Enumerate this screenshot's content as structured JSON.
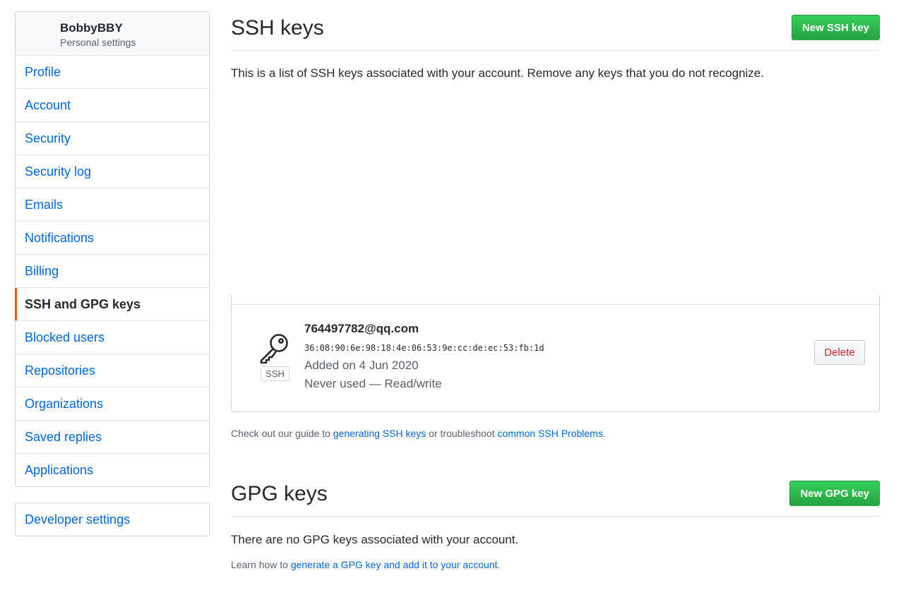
{
  "sidebar": {
    "username": "BobbyBBY",
    "subtitle": "Personal settings",
    "items": [
      {
        "label": "Profile"
      },
      {
        "label": "Account"
      },
      {
        "label": "Security"
      },
      {
        "label": "Security log"
      },
      {
        "label": "Emails"
      },
      {
        "label": "Notifications"
      },
      {
        "label": "Billing"
      },
      {
        "label": "SSH and GPG keys",
        "selected": true
      },
      {
        "label": "Blocked users"
      },
      {
        "label": "Repositories"
      },
      {
        "label": "Organizations"
      },
      {
        "label": "Saved replies"
      },
      {
        "label": "Applications"
      }
    ],
    "developer_settings": "Developer settings"
  },
  "ssh": {
    "title": "SSH keys",
    "new_button": "New SSH key",
    "intro": "This is a list of SSH keys associated with your account. Remove any keys that you do not recognize.",
    "key": {
      "icon": "key-icon",
      "type_label": "SSH",
      "title": "764497782@qq.com",
      "fingerprint": "36:08:90:6e:98:18:4e:06:53:9e:cc:de:ec:53:fb:1d",
      "added": "Added on 4 Jun 2020",
      "usage": "Never used — Read/write",
      "delete_label": "Delete"
    },
    "help_prefix": "Check out our guide to ",
    "help_link1": "generating SSH keys",
    "help_middle": " or troubleshoot ",
    "help_link2": "common SSH Problems",
    "help_suffix": "."
  },
  "gpg": {
    "title": "GPG keys",
    "new_button": "New GPG key",
    "empty": "There are no GPG keys associated with your account.",
    "help_prefix": "Learn how to ",
    "help_link": "generate a GPG key and add it to your account",
    "help_suffix": "."
  },
  "colors": {
    "link": "#0366d6",
    "green": "#28a745",
    "selected_accent": "#e36209",
    "danger": "#cb2431"
  }
}
